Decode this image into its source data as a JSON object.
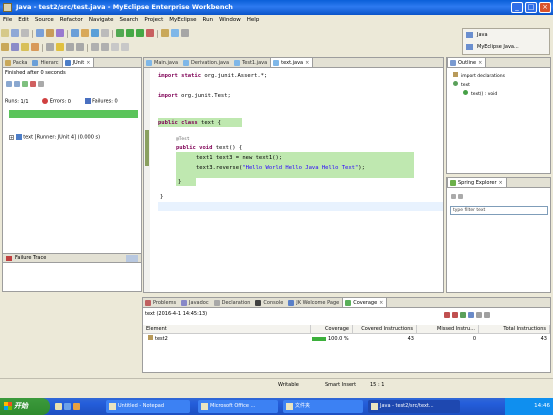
{
  "window": {
    "title": "Java - test2/src/test.java - MyEclipse Enterprise Workbench"
  },
  "menu": [
    "File",
    "Edit",
    "Source",
    "Refactor",
    "Navigate",
    "Search",
    "Project",
    "MyEclipse",
    "Run",
    "Window",
    "Help"
  ],
  "perspectives": [
    "Java",
    "MyEclipse Java..."
  ],
  "left_tabs": [
    {
      "label": "Packa",
      "icon": "package-icon"
    },
    {
      "label": "Hierarc",
      "icon": "hierarchy-icon"
    },
    {
      "label": "JUnit",
      "icon": "junit-icon"
    }
  ],
  "junit": {
    "status": "Finished after 0 seconds",
    "runs_label": "Runs:",
    "runs": "1/1",
    "errors_label": "Errors:",
    "errors": "0",
    "failures_label": "Failures:",
    "failures": "0",
    "tree_item": "text [Runner: JUnit 4] (0.000 s)",
    "failure_trace": "Failure Trace",
    "bar_color": "#5bc45b"
  },
  "editor_tabs": [
    {
      "label": "Main.java"
    },
    {
      "label": "Derivation.java"
    },
    {
      "label": "Test1.java"
    },
    {
      "label": "text.java",
      "active": true
    }
  ],
  "code": {
    "line1_kw": "import static",
    "line1_rest": " org.junit.Assert.*;",
    "line2_kw": "import",
    "line2_rest": " org.junit.Test;",
    "line3_kw": "public class",
    "line3_rest": " text {",
    "annotation": "@Test",
    "line5_kw": "public void",
    "line5_rest": " text() {",
    "line6": "text1 text3 = new text1();",
    "line7_pre": "text3.reverse(",
    "line7_str": "\"Hello World Hello Java Hello Text\"",
    "line7_post": ");",
    "line8": "}",
    "line9": "}"
  },
  "outline": {
    "tab": "Outline",
    "items": [
      "import declarations",
      "text",
      "text() : void"
    ]
  },
  "spring": {
    "tab": "Spring Explorer",
    "filter_placeholder": "type filter text"
  },
  "bottom_tabs": [
    {
      "label": "Problems"
    },
    {
      "label": "Javadoc"
    },
    {
      "label": "Declaration"
    },
    {
      "label": "Console"
    },
    {
      "label": "JK Welcome Page"
    },
    {
      "label": "Coverage",
      "active": true
    }
  ],
  "coverage": {
    "session": "text (2016-4-1 14:45:13)",
    "headers": [
      "Element",
      "Coverage",
      "Covered Instructions",
      "Missed Instru...",
      "Total Instructions"
    ],
    "row": {
      "element": "test2",
      "coverage": "100.0 %",
      "covered": "43",
      "missed": "0",
      "total": "43"
    }
  },
  "status": {
    "mode": "Writable",
    "insert": "Smart Insert",
    "position": "15 : 1"
  },
  "taskbar": {
    "start": "开始",
    "tasks": [
      "Untitled - Notepad",
      "Microsoft Office ...",
      "文件夹",
      "Java - test2/src/text..."
    ],
    "clock": "14:46"
  }
}
